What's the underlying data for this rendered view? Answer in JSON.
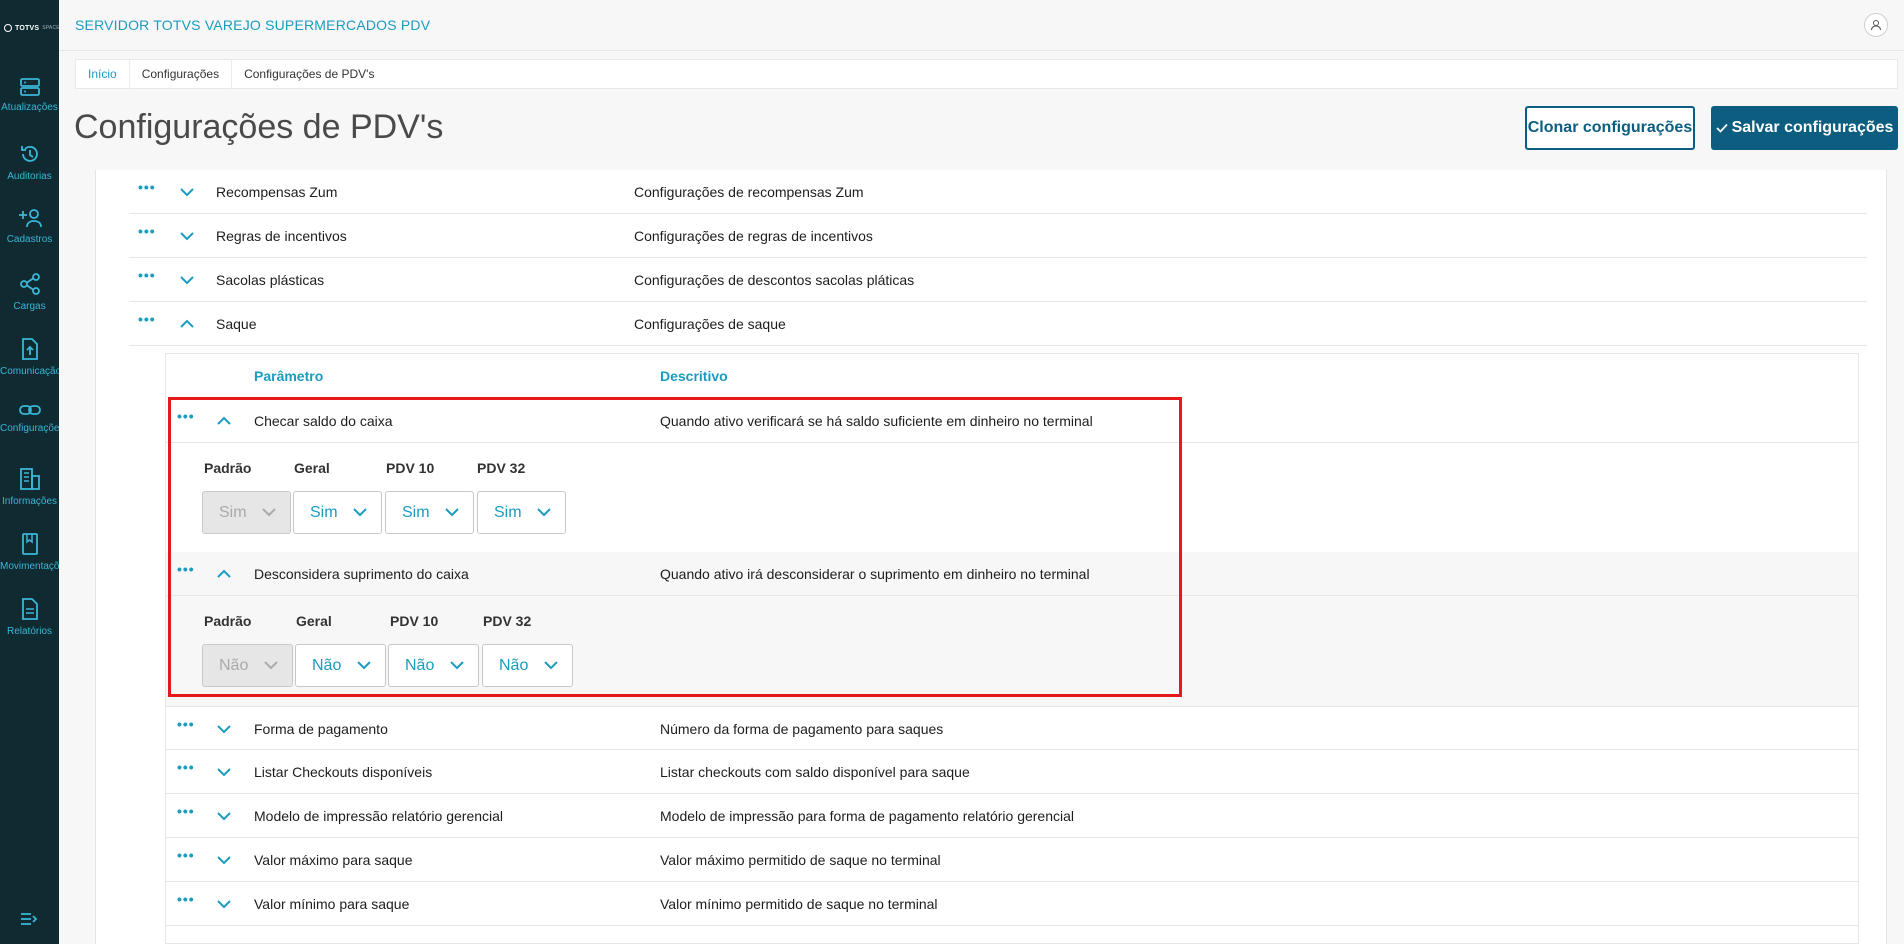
{
  "app": {
    "title": "SERVIDOR TOTVS VAREJO SUPERMERCADOS PDV",
    "logo_text": "TOTVS",
    "logo_sub": "SPACE"
  },
  "sidebar": {
    "items": [
      {
        "label": "Atualizações",
        "icon": "server-icon"
      },
      {
        "label": "Auditorias",
        "icon": "history-icon"
      },
      {
        "label": "Cadastros",
        "icon": "add-user-icon"
      },
      {
        "label": "Cargas",
        "icon": "share-icon"
      },
      {
        "label": "Comunicação",
        "icon": "upload-file-icon"
      },
      {
        "label": "Configurações",
        "icon": "link-icon"
      },
      {
        "label": "Informações",
        "icon": "building-icon"
      },
      {
        "label": "Movimentações",
        "icon": "book-icon"
      },
      {
        "label": "Relatórios",
        "icon": "document-icon"
      }
    ]
  },
  "breadcrumb": [
    "Início",
    "Configurações",
    "Configurações de PDV's"
  ],
  "page": {
    "title": "Configurações de PDV's",
    "clone_button": "Clonar configurações",
    "save_button": "Salvar configurações"
  },
  "groups": [
    {
      "name": "Recompensas Zum",
      "desc": "Configurações de recompensas Zum"
    },
    {
      "name": "Regras de incentivos",
      "desc": "Configurações de regras de incentivos"
    },
    {
      "name": "Sacolas plásticas",
      "desc": "Configurações de descontos sacolas pláticas"
    },
    {
      "name": "Saque",
      "desc": "Configurações de saque"
    }
  ],
  "table_header": {
    "param": "Parâmetro",
    "desc": "Descritivo"
  },
  "params": [
    {
      "name": "Checar saldo do caixa",
      "desc": "Quando ativo verificará se há saldo suficiente em dinheiro no terminal",
      "labels": [
        "Padrão",
        "Geral",
        "PDV 10",
        "PDV 32"
      ],
      "values": [
        "Sim",
        "Sim",
        "Sim",
        "Sim"
      ]
    },
    {
      "name": "Desconsidera suprimento do caixa",
      "desc": "Quando ativo irá desconsiderar o suprimento em dinheiro no terminal",
      "labels": [
        "Padrão",
        "Geral",
        "PDV 10",
        "PDV 32"
      ],
      "values": [
        "Não",
        "Não",
        "Não",
        "Não"
      ]
    },
    {
      "name": "Forma de pagamento",
      "desc": "Número da forma de pagamento para saques"
    },
    {
      "name": "Listar Checkouts disponíveis",
      "desc": "Listar checkouts com saldo disponível para saque"
    },
    {
      "name": "Modelo de impressão relatório gerencial",
      "desc": "Modelo de impressão para forma de pagamento relatório gerencial"
    },
    {
      "name": "Valor máximo para saque",
      "desc": "Valor máximo permitido de saque no terminal"
    },
    {
      "name": "Valor mínimo para saque",
      "desc": "Valor mínimo permitido de saque no terminal"
    }
  ],
  "colors": {
    "accent": "#1a9bbf",
    "primary": "#0c5d80",
    "sidebar": "#0f2a30",
    "highlight": "#e41a1a"
  }
}
